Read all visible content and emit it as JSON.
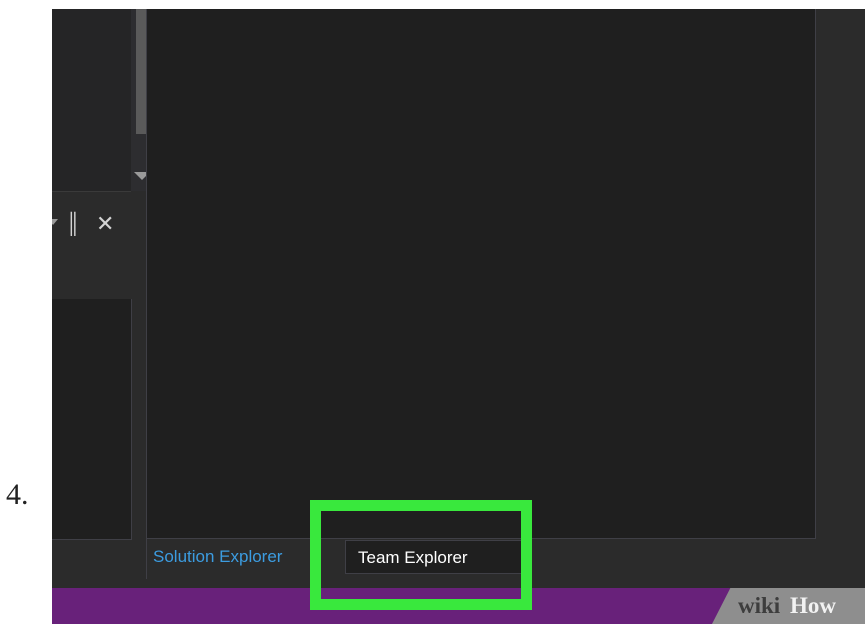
{
  "step": {
    "number": "4."
  },
  "panel": {
    "pin_glyph": "║",
    "close_glyph": "✕"
  },
  "tabs": [
    {
      "label": "Solution Explorer",
      "active": false
    },
    {
      "label": "Team Explorer",
      "active": true
    }
  ],
  "watermark": {
    "wiki": "wiki",
    "how": "How"
  },
  "colors": {
    "ide_background": "#1f1f1f",
    "status_bar": "#68217a",
    "inactive_tab_text": "#3c9ce0",
    "highlight": "#39e83d"
  },
  "icons": [
    "scroll-down-arrow-icon",
    "dropdown-icon",
    "pin-icon",
    "close-icon"
  ]
}
